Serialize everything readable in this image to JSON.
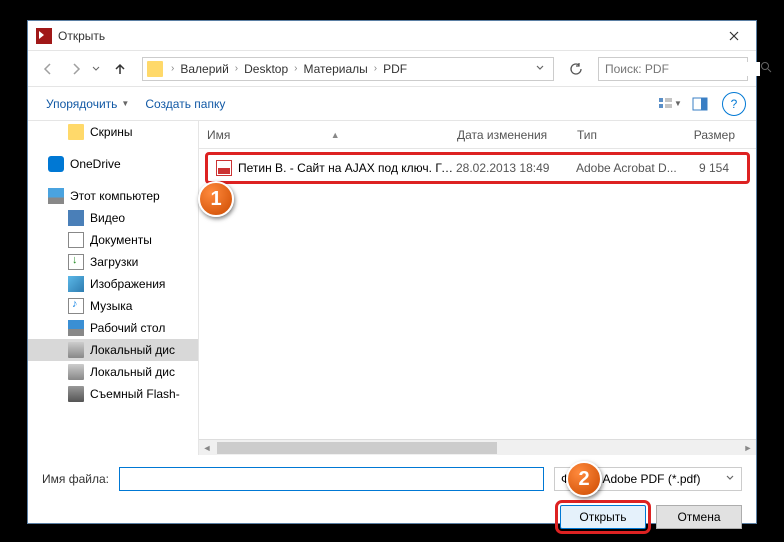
{
  "window": {
    "title": "Открыть"
  },
  "breadcrumb": {
    "items": [
      "Валерий",
      "Desktop",
      "Материалы",
      "PDF"
    ]
  },
  "search": {
    "placeholder": "Поиск: PDF"
  },
  "toolbar": {
    "organize": "Упорядочить",
    "new_folder": "Создать папку"
  },
  "sidebar": {
    "items": [
      {
        "label": "Скрины",
        "icon": "folder",
        "indent": "child"
      },
      {
        "label": "OneDrive",
        "icon": "onedrive"
      },
      {
        "label": "Этот компьютер",
        "icon": "pc"
      },
      {
        "label": "Видео",
        "icon": "video",
        "indent": "child"
      },
      {
        "label": "Документы",
        "icon": "docs",
        "indent": "child"
      },
      {
        "label": "Загрузки",
        "icon": "downloads",
        "indent": "child"
      },
      {
        "label": "Изображения",
        "icon": "images",
        "indent": "child"
      },
      {
        "label": "Музыка",
        "icon": "music",
        "indent": "child"
      },
      {
        "label": "Рабочий стол",
        "icon": "desktop",
        "indent": "child"
      },
      {
        "label": "Локальный дис",
        "icon": "disk",
        "indent": "child",
        "selected": true
      },
      {
        "label": "Локальный дис",
        "icon": "disk",
        "indent": "child"
      },
      {
        "label": "Съемный Flash-",
        "icon": "flash",
        "indent": "child"
      }
    ]
  },
  "columns": {
    "name": "Имя",
    "date": "Дата изменения",
    "type": "Тип",
    "size": "Размер"
  },
  "files": [
    {
      "name": "Петин В. - Сайт на AJAX под ключ. Гот...",
      "date": "28.02.2013 18:49",
      "type": "Adobe Acrobat D...",
      "size": "9 154"
    }
  ],
  "footer": {
    "filename_label": "Имя файла:",
    "filename_value": "",
    "filetype": "Файлы Adobe PDF (*.pdf)",
    "open": "Открыть",
    "cancel": "Отмена"
  },
  "callouts": {
    "one": "1",
    "two": "2"
  }
}
